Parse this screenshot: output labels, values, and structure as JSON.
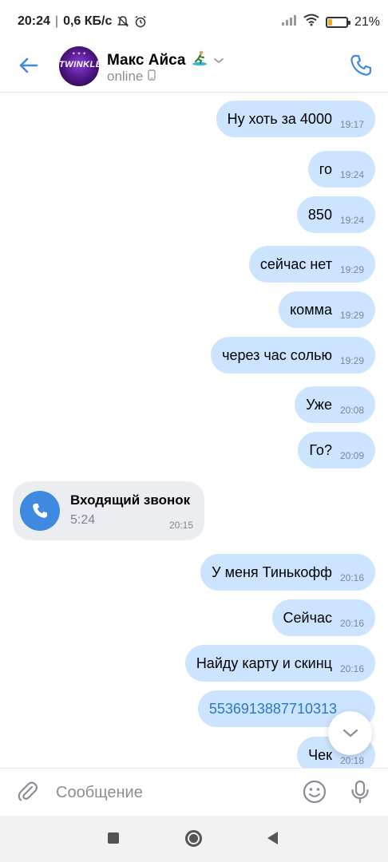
{
  "status_bar": {
    "time": "20:24",
    "speed": "0,6 КБ/с",
    "battery": "21%",
    "battery_level": 0.21
  },
  "header": {
    "contact_name": "Макс Айса",
    "status": "online",
    "avatar_text": "TWINKLE",
    "accent_color": "#3f8ae0"
  },
  "messages": [
    {
      "text": "Ну хоть за 4000",
      "time": "19:17"
    },
    {
      "text": "го",
      "time": "19:24"
    },
    {
      "text": "850",
      "time": "19:24"
    },
    {
      "text": "сейчас нет",
      "time": "19:29"
    },
    {
      "text": "комма",
      "time": "19:29"
    },
    {
      "text": "через час солью",
      "time": "19:29"
    },
    {
      "text": "Уже",
      "time": "20:08"
    },
    {
      "text": "Го?",
      "time": "20:09"
    },
    {
      "text": "У меня Тинькофф",
      "time": "20:16"
    },
    {
      "text": "Сейчас",
      "time": "20:16"
    },
    {
      "text": "Найду карту и скинц",
      "time": "20:16"
    },
    {
      "text": "5536913887710313",
      "time": ""
    },
    {
      "text": "Чек",
      "time": "20:18"
    }
  ],
  "call": {
    "title": "Входящий звонок",
    "duration": "5:24",
    "time": "20:15"
  },
  "composer": {
    "placeholder": "Сообщение"
  },
  "icons": {
    "back": "arrow-left-icon",
    "phone": "phone-icon",
    "attach": "paperclip-icon",
    "emoji": "smile-icon",
    "mic": "microphone-icon",
    "scroll_down": "chevron-down-icon"
  },
  "colors": {
    "outgoing_bubble": "#cce4ff",
    "incoming_bubble": "#ebedf0",
    "link": "#2a78c8"
  }
}
